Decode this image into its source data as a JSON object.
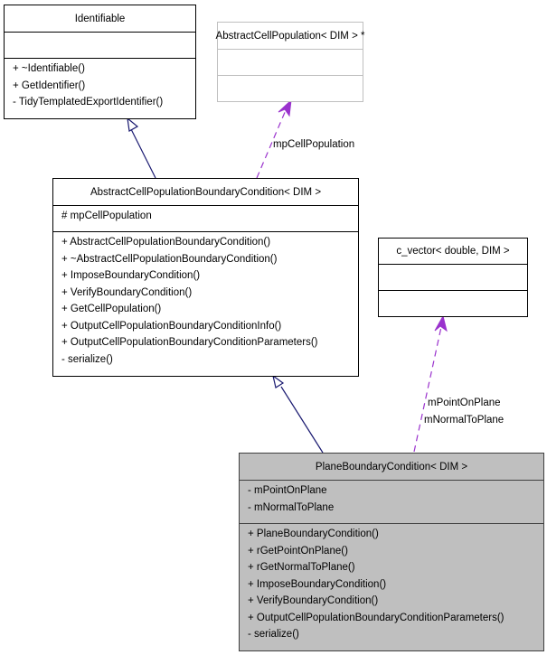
{
  "diagram": {
    "classes": {
      "identifiable": {
        "name": "Identifiable",
        "attributes": [],
        "methods": [
          "+ ~Identifiable()",
          "+ GetIdentifier()",
          "- TidyTemplatedExportIdentifier()"
        ]
      },
      "abstract_cell_population": {
        "name": "AbstractCellPopulation< DIM > *",
        "attributes": [],
        "methods": []
      },
      "abstract_boundary_condition": {
        "name": "AbstractCellPopulationBoundaryCondition< DIM >",
        "attributes": [
          "# mpCellPopulation"
        ],
        "methods": [
          "+ AbstractCellPopulationBoundaryCondition()",
          "+ ~AbstractCellPopulationBoundaryCondition()",
          "+ ImposeBoundaryCondition()",
          "+ VerifyBoundaryCondition()",
          "+ GetCellPopulation()",
          "+ OutputCellPopulationBoundaryConditionInfo()",
          "+ OutputCellPopulationBoundaryConditionParameters()",
          "- serialize()"
        ]
      },
      "c_vector": {
        "name": "c_vector< double, DIM >",
        "attributes": [],
        "methods": []
      },
      "plane_boundary_condition": {
        "name": "PlaneBoundaryCondition< DIM >",
        "attributes": [
          "- mPointOnPlane",
          "- mNormalToPlane"
        ],
        "methods": [
          "+ PlaneBoundaryCondition()",
          "+ rGetPointOnPlane()",
          "+ rGetNormalToPlane()",
          "+ ImposeBoundaryCondition()",
          "+ VerifyBoundaryCondition()",
          "+ OutputCellPopulationBoundaryConditionParameters()",
          "- serialize()"
        ]
      }
    },
    "relations": {
      "inherit_identifiable": {
        "from": "abstract_boundary_condition",
        "to": "identifiable",
        "type": "inheritance"
      },
      "uses_cell_population": {
        "from": "abstract_boundary_condition",
        "to": "abstract_cell_population",
        "type": "usage",
        "label": "mpCellPopulation"
      },
      "inherit_abstract": {
        "from": "plane_boundary_condition",
        "to": "abstract_boundary_condition",
        "type": "inheritance"
      },
      "uses_c_vector": {
        "from": "plane_boundary_condition",
        "to": "c_vector",
        "type": "usage",
        "label_line1": "mPointOnPlane",
        "label_line2": "mNormalToPlane"
      }
    },
    "colors": {
      "inheritance_edge": "#191970",
      "usage_edge": "#9a32cd",
      "focus_fill": "#bfbfbf",
      "ghost_border": "#bfbfbf"
    }
  }
}
